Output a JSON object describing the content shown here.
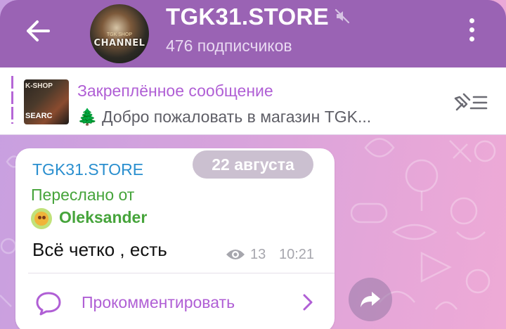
{
  "header": {
    "title": "TGK31.STORE",
    "subscribers": "476 подписчиков",
    "avatar_text": "CHANNEL",
    "avatar_subtext": "TGK SHOP",
    "back_icon": "arrow-left-icon",
    "mute_icon": "muted-speaker-icon",
    "menu_icon": "more-vertical-icon"
  },
  "pinned": {
    "title": "Закреплённое сообщение",
    "text_emoji": "🌲",
    "text": "Добро пожаловать в магазин TGK...",
    "thumb_top": "K-SHOP",
    "thumb_bottom": "SEARC",
    "list_icon": "pin-list-icon"
  },
  "message": {
    "date": "22 августа",
    "sender": "TGK31.STORE",
    "forwarded_label": "Переслано от",
    "forwarded_name": "Oleksander",
    "text": "Всё четко , есть",
    "views": "13",
    "time": "10:21",
    "comment_label": "Прокомментировать",
    "comment_icon": "comment-bubble-icon",
    "views_icon": "eye-icon",
    "share_icon": "share-arrow-icon"
  },
  "colors": {
    "header_bg": "#9a63b4",
    "accent_purple": "#b05fd5",
    "sender_blue": "#2a8fcf",
    "forward_green": "#46a43b"
  }
}
